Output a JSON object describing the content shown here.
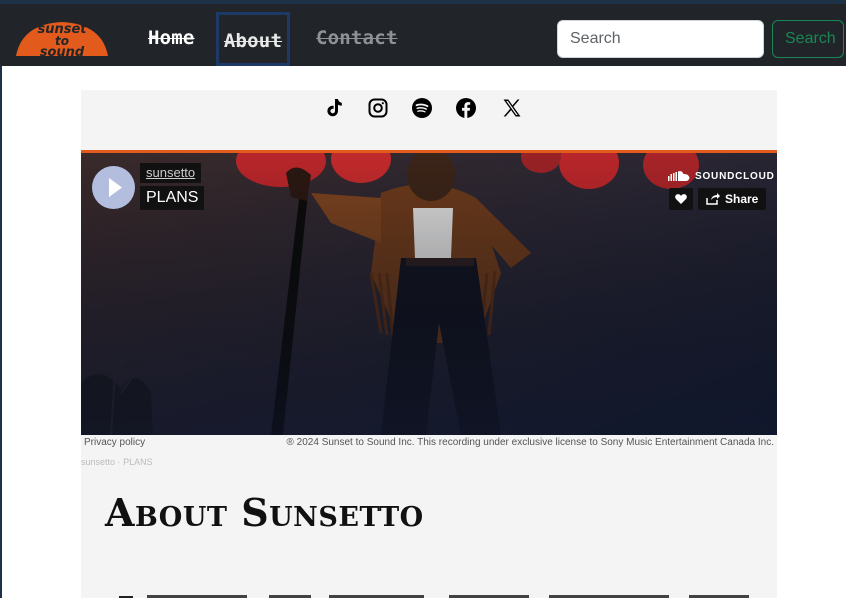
{
  "header": {
    "logo_text": "sunset to sound",
    "nav": [
      {
        "label": "Home"
      },
      {
        "label": "About"
      },
      {
        "label": "Contact"
      }
    ],
    "search": {
      "placeholder": "Search",
      "button_label": "Search"
    }
  },
  "social": {
    "icons": [
      "tiktok-icon",
      "instagram-icon",
      "spotify-icon",
      "facebook-icon",
      "x-icon"
    ]
  },
  "player": {
    "artist": "sunsetto",
    "track": "PLANS",
    "brand": "SOUNDCLOUD",
    "share_label": "Share",
    "privacy_label": "Privacy policy",
    "copyright": "® 2024 Sunset to Sound Inc. This recording under exclusive license to Sony Music Entertainment Canada Inc.",
    "credit_artist": "sunsetto",
    "credit_separator": "·",
    "credit_track": "PLANS"
  },
  "main": {
    "heading": "About Sunsetto"
  },
  "colors": {
    "navbar": "#212529",
    "accent_orange": "#e25a1c",
    "search_green": "#198754",
    "panel": "#f4f4f4"
  }
}
